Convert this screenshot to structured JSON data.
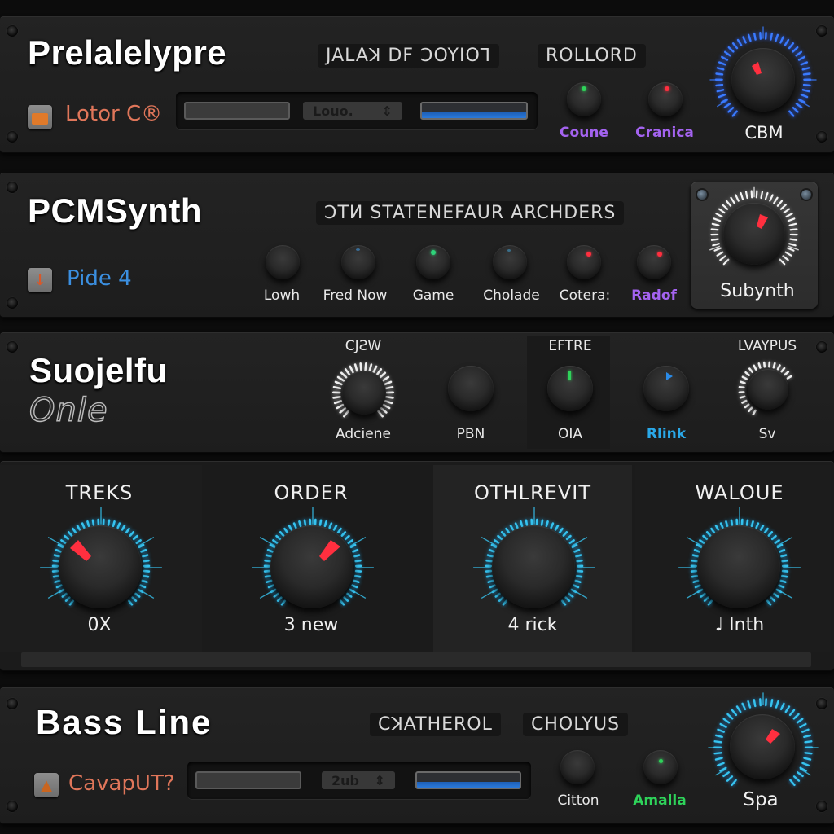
{
  "modules": [
    {
      "title": "Prelalelypre",
      "tags": [
        "JALAꓘ DF ꓛOYIOꓶ",
        "ROLLORD"
      ],
      "preset": {
        "icon": "folder-icon",
        "label": "Lotor C®",
        "color": "#e0765a"
      },
      "display": {
        "combo_value": "Louo.",
        "combo_arrow": "⇕"
      },
      "small_knobs": [
        {
          "label": "Coune",
          "label_color": "#a463f0",
          "indicator_color": "#2fd35a"
        },
        {
          "label": "Cranica",
          "label_color": "#a463f0",
          "indicator_color": "#ff2f3f"
        }
      ],
      "main_knob": {
        "label": "CBM",
        "value_fraction": 0.3,
        "ring_color": "#3a7bff"
      }
    },
    {
      "title": "PCMSynth",
      "tags": [
        "ꓛTИ STATENEFAUR ARCHDERS"
      ],
      "preset": {
        "icon": "download-arrow-icon",
        "label": "Pide 4",
        "color": "#3b8fe0"
      },
      "small_knobs": [
        {
          "label": "Lowh",
          "label_color": "#e8e8e8",
          "indicator_color": ""
        },
        {
          "label": "Fred Now",
          "label_color": "#e8e8e8",
          "indicator_color": "#3a6f9a"
        },
        {
          "label": "Game",
          "label_color": "#e8e8e8",
          "indicator_color": "#2fd37a"
        },
        {
          "label": "Cholade",
          "label_color": "#e8e8e8",
          "indicator_color": "#3a6f8a"
        },
        {
          "label": "Cotera:",
          "label_color": "#e8e8e8",
          "indicator_color": "#ff2f3f"
        },
        {
          "label": "Radof",
          "label_color": "#a463f0",
          "indicator_color": "#ff2f3f"
        }
      ],
      "main_knob": {
        "label": "Subynth",
        "value_fraction": 0.62,
        "ring_color": "#ffffff"
      }
    },
    {
      "title": "Suojelfu",
      "subtitle": "Onle",
      "knobs": [
        {
          "header": "CJƧW",
          "label": "Adciene",
          "label_color": "#e8e8e8",
          "indicator_color": "",
          "ring": "white-full"
        },
        {
          "header": "",
          "label": "PBN",
          "label_color": "#e8e8e8",
          "indicator_color": "",
          "ring": "none"
        },
        {
          "header": "EFTRE",
          "label": "OIA",
          "label_color": "#e8e8e8",
          "indicator_color": "#2fd35a",
          "ring": "none"
        },
        {
          "header": "",
          "label": "Rlink",
          "label_color": "#2aa8e8",
          "indicator_color": "#2a8be8",
          "ring": "none"
        },
        {
          "header": "LVAYPUS",
          "label": "Sv",
          "label_color": "#e8e8e8",
          "indicator_color": "",
          "ring": "white-partial"
        }
      ]
    },
    {
      "sections": [
        {
          "header": "TREKS",
          "value": "0X",
          "value_fraction": 0.15,
          "pointer_visible": true
        },
        {
          "header": "ORDER",
          "value": "3 new",
          "value_fraction": 0.72,
          "pointer_visible": true
        },
        {
          "header": "OTHLREVIT",
          "value": "4 rick",
          "value_fraction": 0.5,
          "pointer_visible": false
        },
        {
          "header": "WALOUE",
          "value": "♩ Inth",
          "value_fraction": 0.5,
          "pointer_visible": false
        }
      ]
    },
    {
      "title": "Bass Line",
      "tags": [
        "CꓘATHEROL",
        "CHOLYUS"
      ],
      "preset": {
        "icon": "animal-icon",
        "label": "CavapUT?",
        "color": "#e0765a"
      },
      "display": {
        "combo_value": "2ub",
        "combo_arrow": "⇕"
      },
      "small_knobs": [
        {
          "label": "Citton",
          "label_color": "#e8e8e8",
          "indicator_color": ""
        },
        {
          "label": "Amalla",
          "label_color": "#2ed35a",
          "indicator_color": "#2fd35a"
        }
      ],
      "main_knob": {
        "label": "Spa",
        "value_fraction": 0.66,
        "ring_color": "#2ab8f0"
      }
    }
  ]
}
